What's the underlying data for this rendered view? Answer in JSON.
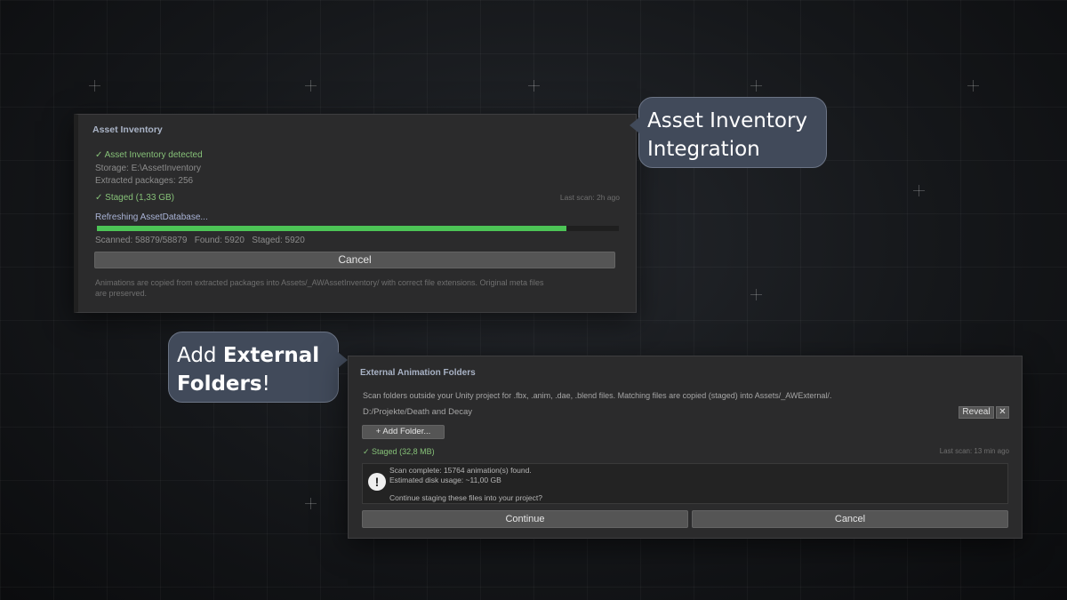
{
  "bubble_top": {
    "line1": "Asset Inventory",
    "line2": "Integration"
  },
  "bubble_left": {
    "prefix": "Add ",
    "bold1": "External",
    "bold2": "Folders",
    "suffix": "!"
  },
  "asset_inventory": {
    "title": "Asset Inventory",
    "detected": "✓ Asset Inventory detected",
    "storage": "Storage: E:\\AssetInventory",
    "extracted": "Extracted packages: 256",
    "staged": "✓ Staged (1,33 GB)",
    "last_scan": "Last scan: 2h ago",
    "refreshing": "Refreshing AssetDatabase...",
    "progress": 0.9,
    "stats": "Scanned: 58879/58879   Found: 5920   Staged: 5920",
    "cancel_label": "Cancel",
    "note_line1": "Animations are copied from extracted packages into Assets/_AWAssetInventory/ with correct file extensions. Original meta files",
    "note_line2": "are preserved."
  },
  "external": {
    "title": "External Animation Folders",
    "description": "Scan folders outside your Unity project for .fbx, .anim, .dae, .blend files. Matching files are copied (staged) into Assets/_AWExternal/.",
    "folder_path": "D:/Projekte/Death and Decay",
    "reveal_label": "Reveal",
    "remove_label": "✕",
    "add_folder_label": "+ Add Folder...",
    "staged": "✓ Staged (32,8 MB)",
    "last_scan": "Last scan: 13 min ago",
    "prompt_line1": "Scan complete: 15764 animation(s) found.",
    "prompt_line2": "Estimated disk usage: ~11,00 GB",
    "prompt_line3": "Continue staging these files into your project?",
    "warning_icon": "!",
    "continue_label": "Continue",
    "cancel_label": "Cancel"
  },
  "colors": {
    "accent_green": "#4cc456",
    "bubble_bg": "#414a5a"
  }
}
